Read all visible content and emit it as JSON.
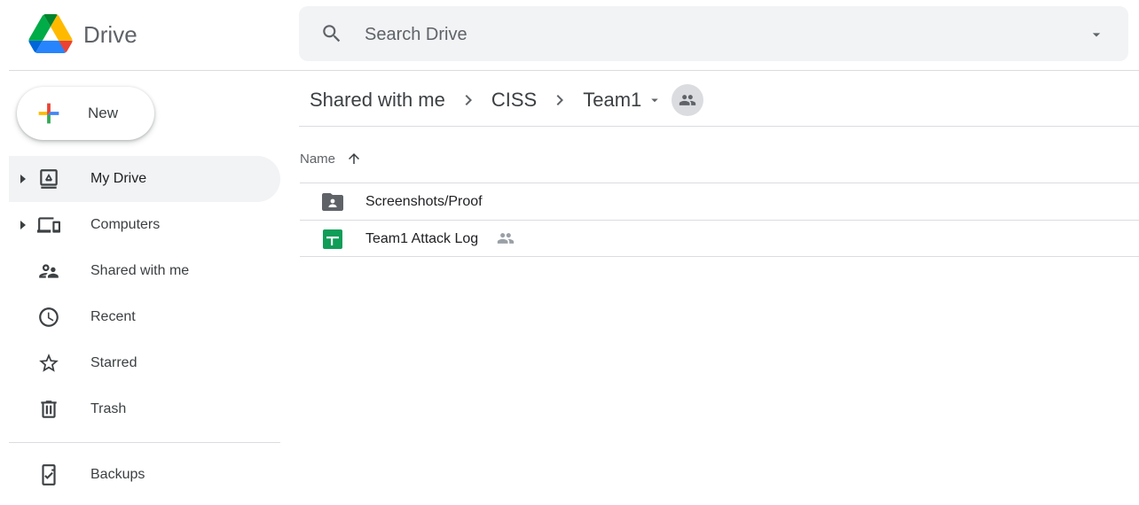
{
  "app": {
    "title": "Drive"
  },
  "search": {
    "placeholder": "Search Drive",
    "value": ""
  },
  "new_button": {
    "label": "New"
  },
  "sidebar": {
    "items": [
      {
        "label": "My Drive",
        "icon": "my-drive-icon",
        "active": true,
        "expandable": true
      },
      {
        "label": "Computers",
        "icon": "computers-icon",
        "active": false,
        "expandable": true
      },
      {
        "label": "Shared with me",
        "icon": "shared-with-me-icon",
        "active": false
      },
      {
        "label": "Recent",
        "icon": "clock-icon",
        "active": false
      },
      {
        "label": "Starred",
        "icon": "star-icon",
        "active": false
      },
      {
        "label": "Trash",
        "icon": "trash-icon",
        "active": false
      },
      {
        "label": "Backups",
        "icon": "backups-icon",
        "active": false
      }
    ]
  },
  "breadcrumb": {
    "items": [
      "Shared with me",
      "CISS"
    ],
    "current": "Team1"
  },
  "list": {
    "column_name": "Name",
    "sort": "ascending",
    "files": [
      {
        "name": "Screenshots/Proof",
        "type": "shared-folder",
        "icon": "shared-folder-icon"
      },
      {
        "name": "Team1 Attack Log",
        "type": "google-sheet",
        "icon": "sheets-icon",
        "shared": true
      }
    ]
  },
  "colors": {
    "accent_blue": "#4285f4",
    "sheets_green": "#0f9d58",
    "folder_gray": "#5f6368",
    "active_bg": "#f1f3f4"
  }
}
